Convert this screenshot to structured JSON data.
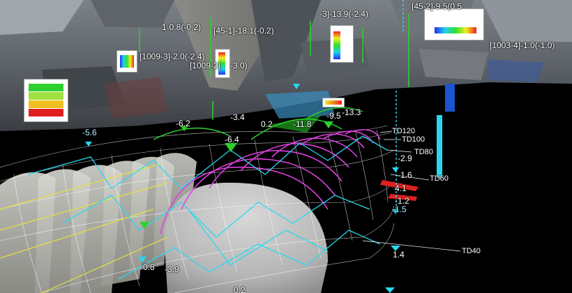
{
  "scene": {
    "colors": {
      "sky": "#000000",
      "lining": "#c9c9c9",
      "wireframe": "#ffffff",
      "magenta": "#e040e0",
      "cyan": "#28d8f0",
      "green": "#2ed12e",
      "red": "#e02020",
      "yellow": "#e6e040"
    }
  },
  "upper_labels": [
    {
      "id": "u1",
      "text": "[45-2]-9.5(0.5"
    },
    {
      "id": "u2",
      "text": "-3]-13.9(-2.4)"
    },
    {
      "id": "u3",
      "text": "1-0.8(-0.2)"
    },
    {
      "id": "u4",
      "text": "[45-1]-18.1(-0.2)"
    },
    {
      "id": "u5",
      "text": "[1009-3]-2.0(-2.4)"
    },
    {
      "id": "u6",
      "text": "[1009-2]"
    },
    {
      "id": "u7",
      "text": "-3.0)"
    },
    {
      "id": "u8",
      "text": "[1003-4]-1.0(-1.0)"
    }
  ],
  "values": [
    {
      "id": "v1",
      "text": "-3.4"
    },
    {
      "id": "v2",
      "text": "0.2"
    },
    {
      "id": "v3",
      "text": "-11.8"
    },
    {
      "id": "v4",
      "text": "-9.5"
    },
    {
      "id": "v5",
      "text": "-13.3"
    },
    {
      "id": "v6",
      "text": "-5.6"
    },
    {
      "id": "v7",
      "text": "-6.2"
    },
    {
      "id": "v8",
      "text": "-6.4"
    },
    {
      "id": "v9",
      "text": "-2.9"
    },
    {
      "id": "v10",
      "text": "-1.6"
    },
    {
      "id": "v11",
      "text": "4.1"
    },
    {
      "id": "v12",
      "text": "-1.2"
    },
    {
      "id": "v13",
      "text": "1.5"
    },
    {
      "id": "v14",
      "text": "1.4"
    },
    {
      "id": "v15",
      "text": "0.8"
    },
    {
      "id": "v16",
      "text": "-3.9"
    },
    {
      "id": "v17",
      "text": "0.2"
    }
  ],
  "stations": [
    {
      "id": "td120",
      "text": "TD120"
    },
    {
      "id": "td100",
      "text": "TD100"
    },
    {
      "id": "td80",
      "text": "TD80"
    },
    {
      "id": "td60",
      "text": "TD60"
    },
    {
      "id": "td40",
      "text": "TD40"
    }
  ]
}
